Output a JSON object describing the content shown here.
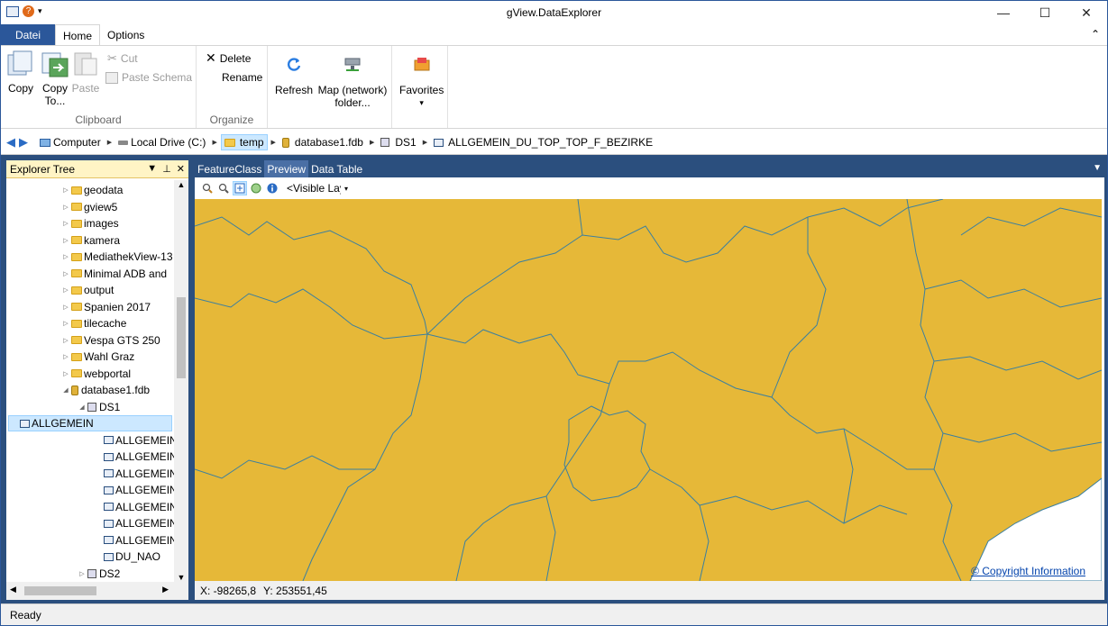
{
  "window": {
    "title": "gView.DataExplorer",
    "minimize": "—",
    "maximize": "☐",
    "close": "✕"
  },
  "ribbon_tabs": [
    {
      "label": "Datei"
    },
    {
      "label": "Home"
    },
    {
      "label": "Options"
    }
  ],
  "ribbon": {
    "clipboard": {
      "label": "Clipboard",
      "copy": "Copy",
      "copy_to": "Copy To...",
      "paste": "Paste",
      "cut": "Cut",
      "paste_schema": "Paste Schema"
    },
    "organize": {
      "label": "Organize",
      "delete": "Delete",
      "rename": "Rename"
    },
    "refresh": "Refresh",
    "map_network_folder": "Map (network) folder...",
    "favorites": "Favorites",
    "favorites_arrow": "▾"
  },
  "breadcrumb": [
    {
      "label": "Computer",
      "icon": "computer-icon"
    },
    {
      "label": "Local Drive (C:)",
      "icon": "drive-icon"
    },
    {
      "label": "temp",
      "icon": "folder-icon"
    },
    {
      "label": "database1.fdb",
      "icon": "database-icon"
    },
    {
      "label": "DS1",
      "icon": "dataset-icon"
    },
    {
      "label": "ALLGEMEIN_DU_TOP_TOP_F_BEZIRKE",
      "icon": "featureclass-icon"
    }
  ],
  "explorer": {
    "title": "Explorer Tree",
    "tree": [
      {
        "label": "geodata",
        "type": "folder"
      },
      {
        "label": "gview5",
        "type": "folder"
      },
      {
        "label": "images",
        "type": "folder"
      },
      {
        "label": "kamera",
        "type": "folder"
      },
      {
        "label": "MediathekView-13",
        "type": "folder"
      },
      {
        "label": "Minimal ADB and",
        "type": "folder"
      },
      {
        "label": "output",
        "type": "folder"
      },
      {
        "label": "Spanien 2017",
        "type": "folder"
      },
      {
        "label": "tilecache",
        "type": "folder"
      },
      {
        "label": "Vespa GTS 250",
        "type": "folder"
      },
      {
        "label": "Wahl Graz",
        "type": "folder"
      },
      {
        "label": "webportal",
        "type": "folder"
      },
      {
        "label": "database1.fdb",
        "type": "database"
      },
      {
        "label": "DS1",
        "type": "dataset"
      },
      {
        "label": "ALLGEMEIN",
        "type": "featureclass"
      },
      {
        "label": "ALLGEMEIN",
        "type": "featureclass"
      },
      {
        "label": "ALLGEMEIN",
        "type": "featureclass"
      },
      {
        "label": "ALLGEMEIN",
        "type": "featureclass"
      },
      {
        "label": "ALLGEMEIN",
        "type": "featureclass"
      },
      {
        "label": "ALLGEMEIN",
        "type": "featureclass"
      },
      {
        "label": "ALLGEMEIN",
        "type": "featureclass"
      },
      {
        "label": "ALLGEMEIN",
        "type": "featureclass"
      },
      {
        "label": "DU_NAO",
        "type": "featureclass"
      },
      {
        "label": "DS2",
        "type": "dataset"
      }
    ]
  },
  "doc_tabs": [
    {
      "label": "FeatureClass"
    },
    {
      "label": "Preview"
    },
    {
      "label": "Data Table"
    }
  ],
  "preview": {
    "layer_combo": "<Visible Lay",
    "copyright": "© Copyright Information",
    "coord_x": "X: -98265,8",
    "coord_y": "Y: 253551,45",
    "map_fill": "#e6b838",
    "border_color": "#3a7fa0"
  },
  "status": "Ready"
}
